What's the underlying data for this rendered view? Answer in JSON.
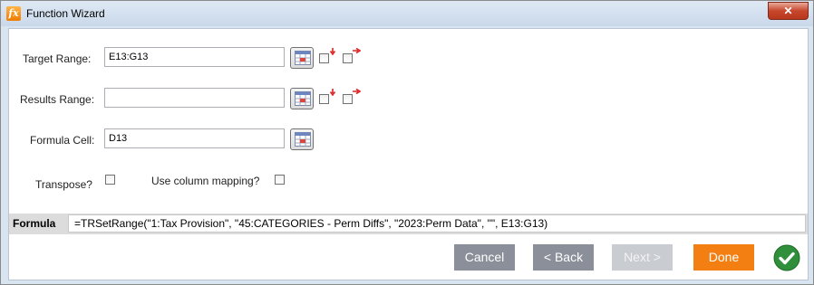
{
  "window": {
    "title": "Function Wizard",
    "app_icon_text": "fx",
    "close_label": "✕"
  },
  "form": {
    "target_range": {
      "label": "Target Range:",
      "value": "E13:G13"
    },
    "results_range": {
      "label": "Results Range:",
      "value": ""
    },
    "formula_cell": {
      "label": "Formula Cell:",
      "value": "D13"
    },
    "transpose": {
      "label": "Transpose?",
      "checked": false
    },
    "column_mapping": {
      "label": "Use column mapping?",
      "checked": false
    }
  },
  "formula_bar": {
    "label": "Formula",
    "value": "=TRSetRange(\"1:Tax Provision\", \"45:CATEGORIES - Perm Diffs\", \"2023:Perm Data\", \"\", E13:G13)"
  },
  "buttons": {
    "cancel": "Cancel",
    "back": "< Back",
    "next": "Next >",
    "done": "Done"
  },
  "colors": {
    "done": "#f37f12",
    "ok_check": "#2f8f3a"
  },
  "icons": {
    "range_picker": "range-select-icon",
    "expand_down": "expand-down-icon",
    "expand_right": "expand-right-icon",
    "ok": "checkmark-circle-icon"
  }
}
